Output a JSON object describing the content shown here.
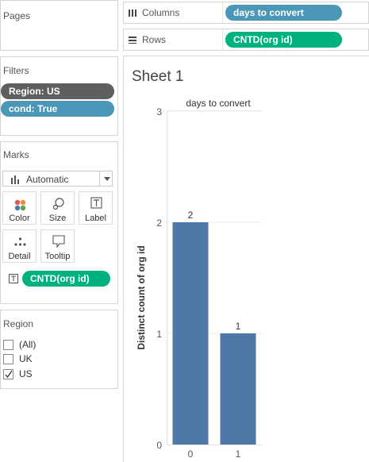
{
  "pages": {
    "title": "Pages"
  },
  "filters": {
    "title": "Filters",
    "items": [
      {
        "label": "Region: US",
        "color": "#5f5f5f"
      },
      {
        "label": "cond: True",
        "color": "#4a97b7"
      }
    ]
  },
  "marks": {
    "title": "Marks",
    "type_selected": "Automatic",
    "buttons": [
      {
        "label": "Color",
        "icon": "color-dots-icon"
      },
      {
        "label": "Size",
        "icon": "size-icon"
      },
      {
        "label": "Label",
        "icon": "label-icon"
      },
      {
        "label": "Detail",
        "icon": "detail-dots-icon"
      },
      {
        "label": "Tooltip",
        "icon": "tooltip-icon"
      }
    ],
    "field_pill": "CNTD(org id)"
  },
  "region_filter": {
    "title": "Region",
    "options": [
      {
        "label": "(All)",
        "checked": false
      },
      {
        "label": "UK",
        "checked": false
      },
      {
        "label": "US",
        "checked": true
      }
    ]
  },
  "shelves": {
    "columns": {
      "label": "Columns",
      "pill": "days to convert"
    },
    "rows": {
      "label": "Rows",
      "pill": "CNTD(org id)"
    }
  },
  "sheet": {
    "title": "Sheet 1"
  },
  "colors": {
    "bar": "#4e79a7",
    "pill_green": "#00b180",
    "pill_blue": "#4a97b7",
    "pill_gray": "#5f5f5f"
  },
  "chart_data": {
    "type": "bar",
    "title": "days to convert",
    "xlabel": "",
    "ylabel": "Distinct count of org id",
    "categories": [
      "0",
      "1"
    ],
    "values": [
      2,
      1
    ],
    "data_labels": [
      "2",
      "1"
    ],
    "ylim": [
      0,
      3
    ],
    "yticks": [
      "0",
      "1",
      "2",
      "3"
    ],
    "grid": true
  }
}
